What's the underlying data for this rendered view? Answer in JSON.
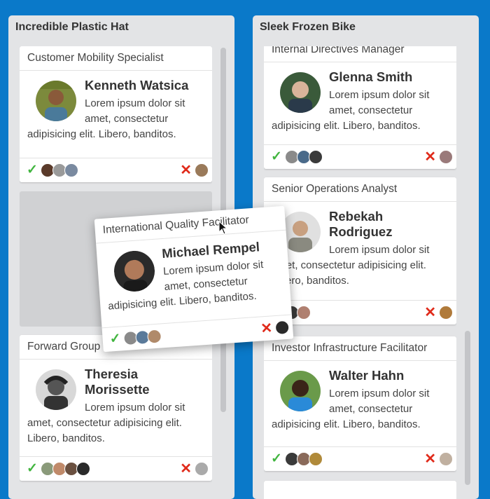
{
  "columns": [
    {
      "title": "Incredible Plastic Hat",
      "cards": [
        {
          "role": "Customer Mobility Specialist",
          "name_lines": [
            "Kenneth Watsica"
          ],
          "description": "Lorem ipsum dolor sit amet, consectetur adipisicing elit. Libero, banditos."
        },
        {
          "role": "Forward Group",
          "name_lines": [
            "Theresia",
            "Morissette"
          ],
          "description": "Lorem ipsum dolor sit amet, consectetur adipisicing elit. Libero, banditos."
        }
      ]
    },
    {
      "title": "Sleek Frozen Bike",
      "cards": [
        {
          "role": "Internal Directives Manager",
          "name_lines": [
            "Glenna Smith"
          ],
          "description": "Lorem ipsum dolor sit amet, consectetur adipisicing elit. Libero, banditos."
        },
        {
          "role": "Senior Operations Analyst",
          "name_lines": [
            "Rebekah",
            "Rodriguez"
          ],
          "description": "Lorem ipsum dolor sit amet, consectetur adipisicing elit. Libero, banditos."
        },
        {
          "role": "Investor Infrastructure Facilitator",
          "name_lines": [
            "Walter Hahn"
          ],
          "description": "Lorem ipsum dolor sit amet, consectetur adipisicing elit. Libero, banditos."
        }
      ]
    }
  ],
  "dragged_card": {
    "role": "International Quality Facilitator",
    "name_lines": [
      "Michael Rempel"
    ],
    "description": "Lorem ipsum dolor sit amet, consectetur adipisicing elit. Libero, banditos."
  },
  "icons": {
    "approve": "checkmark-icon",
    "reject": "cross-icon"
  },
  "colors": {
    "background": "#0a79c9",
    "approve": "#41b53f",
    "reject": "#e02a1a"
  }
}
